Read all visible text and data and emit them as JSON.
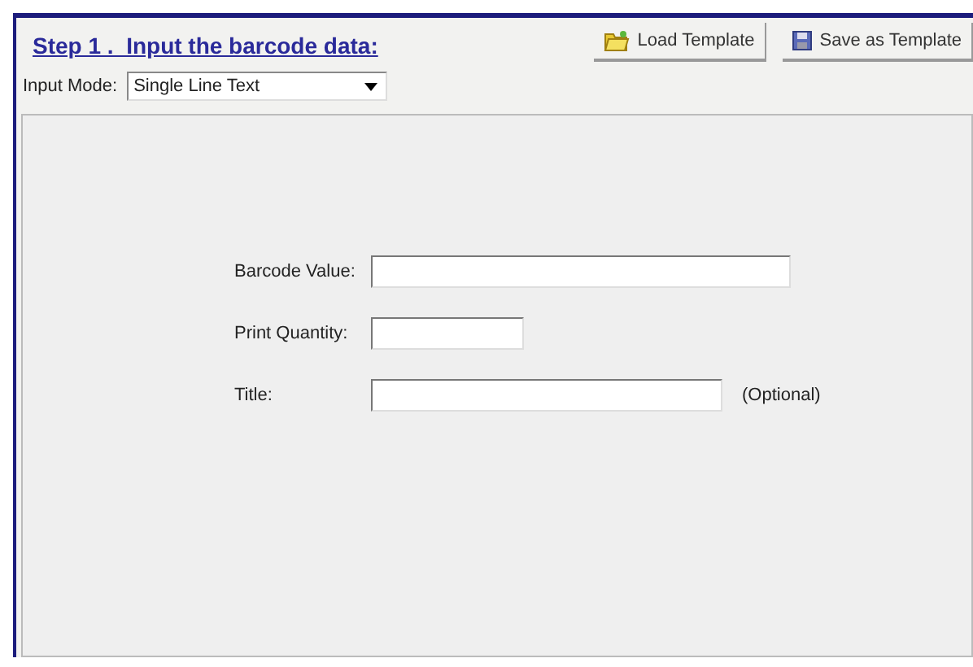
{
  "heading": "Step 1 .  Input the barcode data:",
  "buttons": [
    {
      "label": "Load Template",
      "kind": "load"
    },
    {
      "label": "Save as Template",
      "kind": "save"
    }
  ],
  "input_mode": {
    "label": "Input Mode:",
    "value": "Single Line Text"
  },
  "fields": [
    {
      "label": "Barcode Value:"
    },
    {
      "label": "Print Quantity:"
    },
    {
      "label": "Title:",
      "note": "(Optional)"
    }
  ]
}
